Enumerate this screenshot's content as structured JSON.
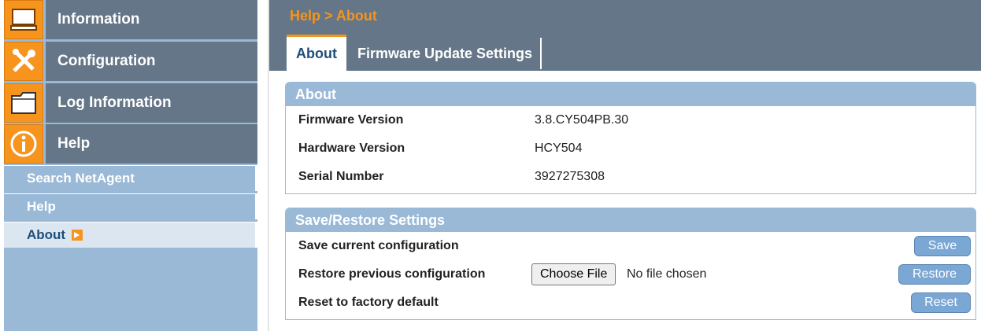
{
  "sidebar": {
    "menu": [
      {
        "label": "Information",
        "icon": "computer-icon"
      },
      {
        "label": "Configuration",
        "icon": "tools-icon"
      },
      {
        "label": "Log Information",
        "icon": "folder-icon"
      },
      {
        "label": "Help",
        "icon": "info-icon"
      }
    ],
    "submenu": [
      {
        "label": "Search NetAgent"
      },
      {
        "label": "Help"
      },
      {
        "label": "About",
        "active": true
      }
    ]
  },
  "header": {
    "breadcrumb": "Help > About",
    "tabs": [
      {
        "label": "About",
        "active": true
      },
      {
        "label": "Firmware Update Settings"
      }
    ]
  },
  "about": {
    "title": "About",
    "rows": [
      {
        "label": "Firmware Version",
        "value": "3.8.CY504PB.30"
      },
      {
        "label": "Hardware Version",
        "value": "HCY504"
      },
      {
        "label": "Serial Number",
        "value": "3927275308"
      }
    ]
  },
  "save_restore": {
    "title": "Save/Restore Settings",
    "save_label": "Save current configuration",
    "save_button": "Save",
    "restore_label": "Restore previous configuration",
    "choose_file": "Choose File",
    "file_status": "No file chosen",
    "restore_button": "Restore",
    "reset_label": "Reset to factory default",
    "reset_button": "Reset"
  },
  "colors": {
    "accent": "#f7941d",
    "header": "#647687",
    "sidebar": "#9ab9d6"
  }
}
